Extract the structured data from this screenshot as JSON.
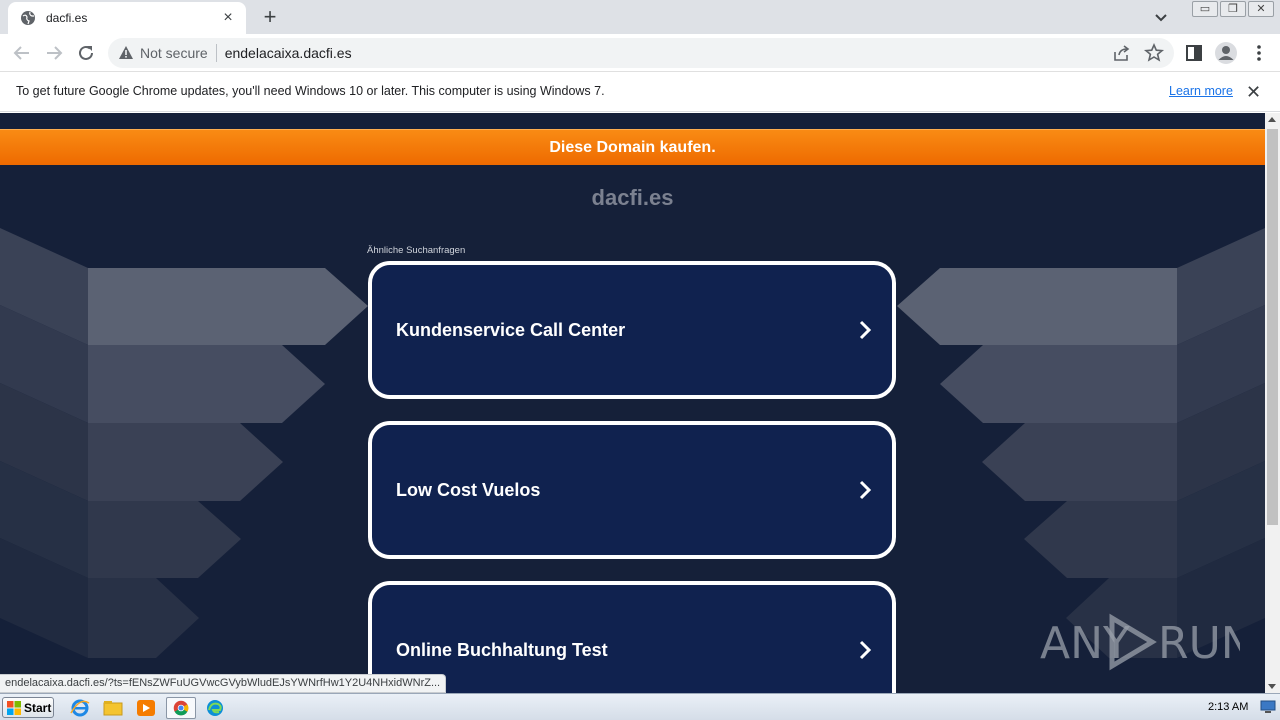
{
  "browser": {
    "tab_title": "dacfi.es",
    "new_tab_symbol": "+",
    "tab_close_symbol": "×",
    "security_label": "Not secure",
    "url": "endelacaixa.dacfi.es",
    "window_buttons": {
      "minimize": "▭",
      "restore": "❐",
      "close": "✕"
    }
  },
  "infobar": {
    "message": "To get future Google Chrome updates, you'll need Windows 10 or later. This computer is using Windows 7.",
    "learn_more": "Learn more",
    "close_symbol": "✕"
  },
  "page": {
    "buy_banner": "Diese Domain kaufen.",
    "domain_title": "dacfi.es",
    "related_label": "Ähnliche Suchanfragen",
    "cards": [
      {
        "label": "Kundenservice Call Center"
      },
      {
        "label": "Low Cost Vuelos"
      },
      {
        "label": "Online Buchhaltung Test"
      }
    ],
    "status_url": "endelacaixa.dacfi.es/?ts=fENsZWFuUGVwcGVybWludEJsYWNrfHw1Y2U4NHxidWNrZ..."
  },
  "watermark": "ANY RUN",
  "taskbar": {
    "start_label": "Start",
    "clock": "2:13 AM",
    "apps": [
      "ie-icon",
      "explorer-icon",
      "media-player-icon",
      "chrome-icon",
      "edge-icon"
    ]
  },
  "colors": {
    "banner_orange": "#f98b14",
    "page_bg": "#152039",
    "card_bg": "#10224f",
    "link_blue": "#1a73e8"
  }
}
